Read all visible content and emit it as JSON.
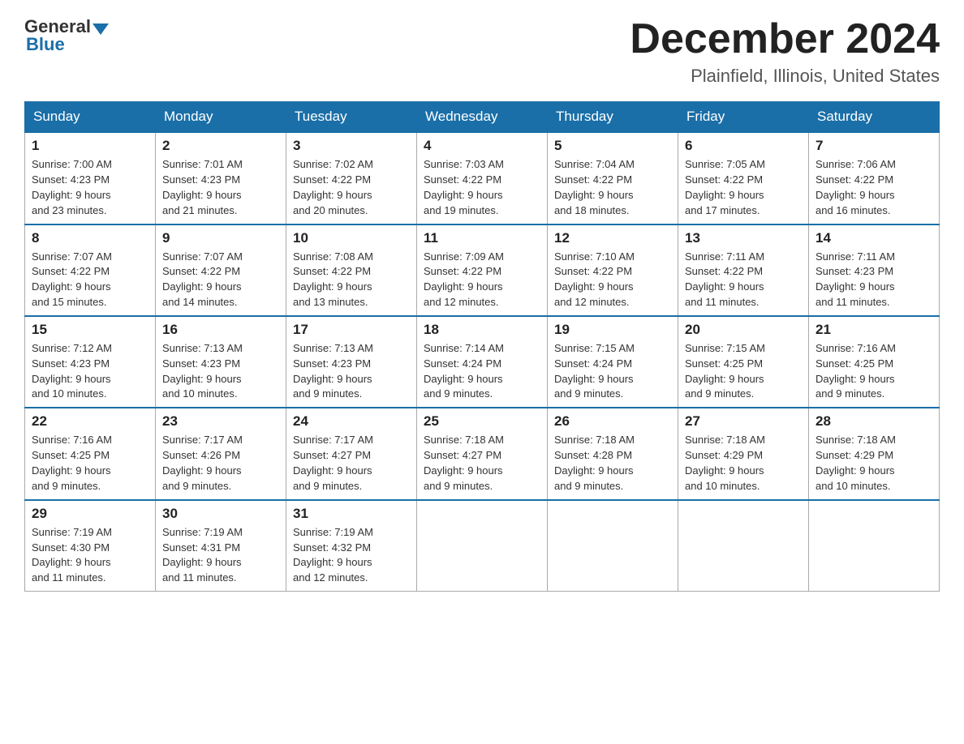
{
  "header": {
    "logo_general": "General",
    "logo_blue": "Blue",
    "month_title": "December 2024",
    "location": "Plainfield, Illinois, United States"
  },
  "days_of_week": [
    "Sunday",
    "Monday",
    "Tuesday",
    "Wednesday",
    "Thursday",
    "Friday",
    "Saturday"
  ],
  "weeks": [
    [
      {
        "day": "1",
        "sunrise": "7:00 AM",
        "sunset": "4:23 PM",
        "daylight": "9 hours and 23 minutes."
      },
      {
        "day": "2",
        "sunrise": "7:01 AM",
        "sunset": "4:23 PM",
        "daylight": "9 hours and 21 minutes."
      },
      {
        "day": "3",
        "sunrise": "7:02 AM",
        "sunset": "4:22 PM",
        "daylight": "9 hours and 20 minutes."
      },
      {
        "day": "4",
        "sunrise": "7:03 AM",
        "sunset": "4:22 PM",
        "daylight": "9 hours and 19 minutes."
      },
      {
        "day": "5",
        "sunrise": "7:04 AM",
        "sunset": "4:22 PM",
        "daylight": "9 hours and 18 minutes."
      },
      {
        "day": "6",
        "sunrise": "7:05 AM",
        "sunset": "4:22 PM",
        "daylight": "9 hours and 17 minutes."
      },
      {
        "day": "7",
        "sunrise": "7:06 AM",
        "sunset": "4:22 PM",
        "daylight": "9 hours and 16 minutes."
      }
    ],
    [
      {
        "day": "8",
        "sunrise": "7:07 AM",
        "sunset": "4:22 PM",
        "daylight": "9 hours and 15 minutes."
      },
      {
        "day": "9",
        "sunrise": "7:07 AM",
        "sunset": "4:22 PM",
        "daylight": "9 hours and 14 minutes."
      },
      {
        "day": "10",
        "sunrise": "7:08 AM",
        "sunset": "4:22 PM",
        "daylight": "9 hours and 13 minutes."
      },
      {
        "day": "11",
        "sunrise": "7:09 AM",
        "sunset": "4:22 PM",
        "daylight": "9 hours and 12 minutes."
      },
      {
        "day": "12",
        "sunrise": "7:10 AM",
        "sunset": "4:22 PM",
        "daylight": "9 hours and 12 minutes."
      },
      {
        "day": "13",
        "sunrise": "7:11 AM",
        "sunset": "4:22 PM",
        "daylight": "9 hours and 11 minutes."
      },
      {
        "day": "14",
        "sunrise": "7:11 AM",
        "sunset": "4:23 PM",
        "daylight": "9 hours and 11 minutes."
      }
    ],
    [
      {
        "day": "15",
        "sunrise": "7:12 AM",
        "sunset": "4:23 PM",
        "daylight": "9 hours and 10 minutes."
      },
      {
        "day": "16",
        "sunrise": "7:13 AM",
        "sunset": "4:23 PM",
        "daylight": "9 hours and 10 minutes."
      },
      {
        "day": "17",
        "sunrise": "7:13 AM",
        "sunset": "4:23 PM",
        "daylight": "9 hours and 9 minutes."
      },
      {
        "day": "18",
        "sunrise": "7:14 AM",
        "sunset": "4:24 PM",
        "daylight": "9 hours and 9 minutes."
      },
      {
        "day": "19",
        "sunrise": "7:15 AM",
        "sunset": "4:24 PM",
        "daylight": "9 hours and 9 minutes."
      },
      {
        "day": "20",
        "sunrise": "7:15 AM",
        "sunset": "4:25 PM",
        "daylight": "9 hours and 9 minutes."
      },
      {
        "day": "21",
        "sunrise": "7:16 AM",
        "sunset": "4:25 PM",
        "daylight": "9 hours and 9 minutes."
      }
    ],
    [
      {
        "day": "22",
        "sunrise": "7:16 AM",
        "sunset": "4:25 PM",
        "daylight": "9 hours and 9 minutes."
      },
      {
        "day": "23",
        "sunrise": "7:17 AM",
        "sunset": "4:26 PM",
        "daylight": "9 hours and 9 minutes."
      },
      {
        "day": "24",
        "sunrise": "7:17 AM",
        "sunset": "4:27 PM",
        "daylight": "9 hours and 9 minutes."
      },
      {
        "day": "25",
        "sunrise": "7:18 AM",
        "sunset": "4:27 PM",
        "daylight": "9 hours and 9 minutes."
      },
      {
        "day": "26",
        "sunrise": "7:18 AM",
        "sunset": "4:28 PM",
        "daylight": "9 hours and 9 minutes."
      },
      {
        "day": "27",
        "sunrise": "7:18 AM",
        "sunset": "4:29 PM",
        "daylight": "9 hours and 10 minutes."
      },
      {
        "day": "28",
        "sunrise": "7:18 AM",
        "sunset": "4:29 PM",
        "daylight": "9 hours and 10 minutes."
      }
    ],
    [
      {
        "day": "29",
        "sunrise": "7:19 AM",
        "sunset": "4:30 PM",
        "daylight": "9 hours and 11 minutes."
      },
      {
        "day": "30",
        "sunrise": "7:19 AM",
        "sunset": "4:31 PM",
        "daylight": "9 hours and 11 minutes."
      },
      {
        "day": "31",
        "sunrise": "7:19 AM",
        "sunset": "4:32 PM",
        "daylight": "9 hours and 12 minutes."
      },
      null,
      null,
      null,
      null
    ]
  ],
  "labels": {
    "sunrise": "Sunrise:",
    "sunset": "Sunset:",
    "daylight": "Daylight:"
  }
}
